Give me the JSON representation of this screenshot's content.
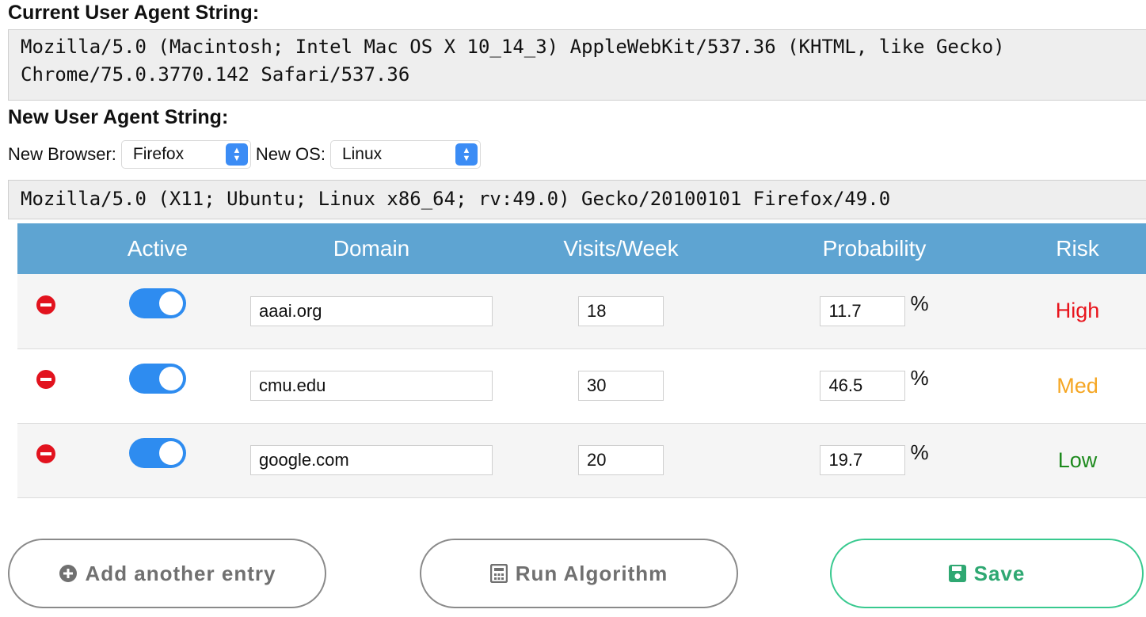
{
  "current": {
    "heading": "Current User Agent String:",
    "line1": "Mozilla/5.0 (Macintosh; Intel Mac OS X 10_14_3) AppleWebKit/537.36 (KHTML, like Gecko)",
    "line2": "Chrome/75.0.3770.142 Safari/537.36"
  },
  "new": {
    "heading": "New User Agent String:",
    "browser_label": "New Browser:",
    "browser_value": "Firefox",
    "os_label": "New OS:",
    "os_value": "Linux",
    "ua": "Mozilla/5.0 (X11; Ubuntu; Linux x86_64; rv:49.0) Gecko/20100101 Firefox/49.0"
  },
  "table": {
    "headers": [
      "",
      "Active",
      "Domain",
      "Visits/Week",
      "Probability",
      "Risk"
    ],
    "rows": [
      {
        "active": true,
        "domain": "aaai.org",
        "visits": "18",
        "probability": "11.7",
        "unit": "%",
        "risk": "High",
        "risk_color": "#e8141c"
      },
      {
        "active": true,
        "domain": "cmu.edu",
        "visits": "30",
        "probability": "46.5",
        "unit": "%",
        "risk": "Med",
        "risk_color": "#f5a623"
      },
      {
        "active": true,
        "domain": "google.com",
        "visits": "20",
        "probability": "19.7",
        "unit": "%",
        "risk": "Low",
        "risk_color": "#1d8a1d"
      }
    ]
  },
  "buttons": {
    "add": {
      "label": "Add another entry",
      "icon": "plus-circle-icon"
    },
    "run": {
      "label": "Run Algorithm",
      "icon": "calculator-icon"
    },
    "save": {
      "label": "Save",
      "icon": "floppy-disk-icon"
    }
  },
  "colors": {
    "header_bg": "#5ea4d2",
    "toggle_on": "#2e8cf0",
    "remove": "#e2131e",
    "save_accent": "#38c98f"
  }
}
